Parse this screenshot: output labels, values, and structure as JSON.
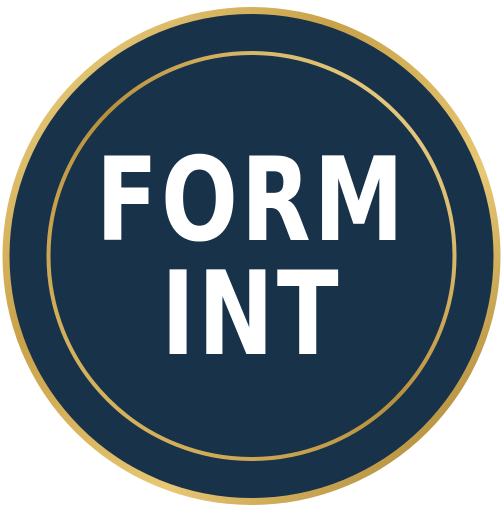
{
  "badge": {
    "line1": "FORM",
    "line2": "INT"
  },
  "colors": {
    "fill": "#183249",
    "gold": "#c9a24a",
    "gold_light": "#f2d98c",
    "gold_dark": "#9a7424",
    "text": "#ffffff"
  }
}
